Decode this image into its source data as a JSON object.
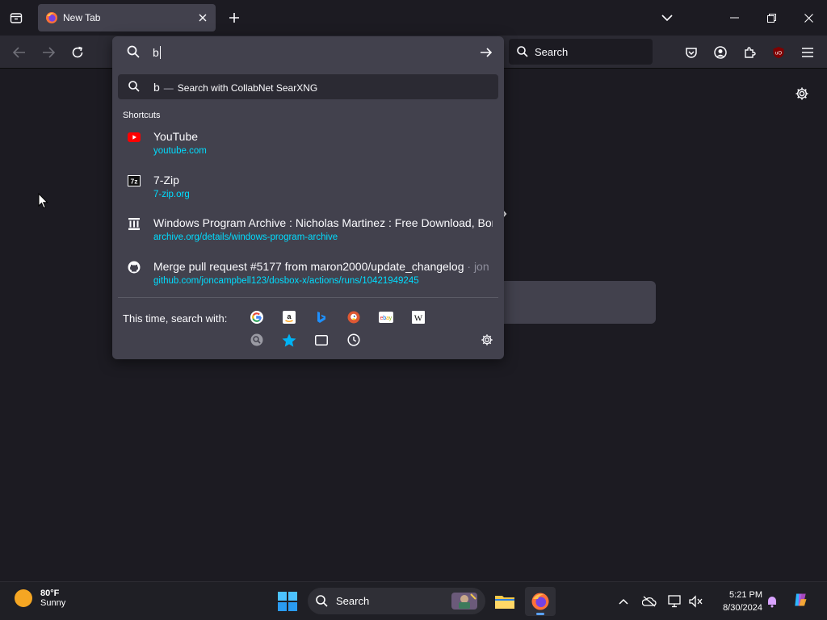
{
  "browser": {
    "tab": {
      "title": "New Tab"
    },
    "nav": {
      "search_placeholder": "Search"
    }
  },
  "urlbar": {
    "input_value": "b",
    "search_row": {
      "query": "b",
      "separator": "—",
      "action": "Search with CollabNet SearXNG"
    },
    "section_title": "Shortcuts",
    "shortcuts": [
      {
        "title": "YouTube",
        "extra": "",
        "url": "youtube.com",
        "icon": "youtube-icon"
      },
      {
        "title": "7-Zip",
        "extra": "",
        "url": "7-zip.org",
        "icon": "7zip-icon"
      },
      {
        "title": "Windows Program Archive : Nicholas Martinez : Free Download, Bor",
        "extra": "",
        "url": "archive.org/details/windows-program-archive",
        "icon": "archive-org-icon"
      },
      {
        "title": "Merge pull request #5177 from maron2000/update_changelog",
        "extra": " · jon",
        "url": "github.com/joncampbell123/dosbox-x/actions/runs/10421949245",
        "icon": "github-icon"
      }
    ],
    "one_off_label": "This time, search with:",
    "engines": [
      "google-icon",
      "amazon-icon",
      "bing-icon",
      "duckduckgo-icon",
      "ebay-icon",
      "wikipedia-icon",
      "searxng-icon",
      "bookmarks-icon",
      "tabs-icon",
      "history-icon"
    ]
  },
  "taskbar": {
    "weather": {
      "temp": "80°F",
      "condition": "Sunny"
    },
    "search_label": "Search",
    "clock": {
      "time": "5:21 PM",
      "date": "8/30/2024"
    }
  },
  "colors": {
    "accent_url": "#00ddff",
    "panel": "#42414d",
    "toolbar": "#2b2a33",
    "background": "#1c1b22"
  }
}
